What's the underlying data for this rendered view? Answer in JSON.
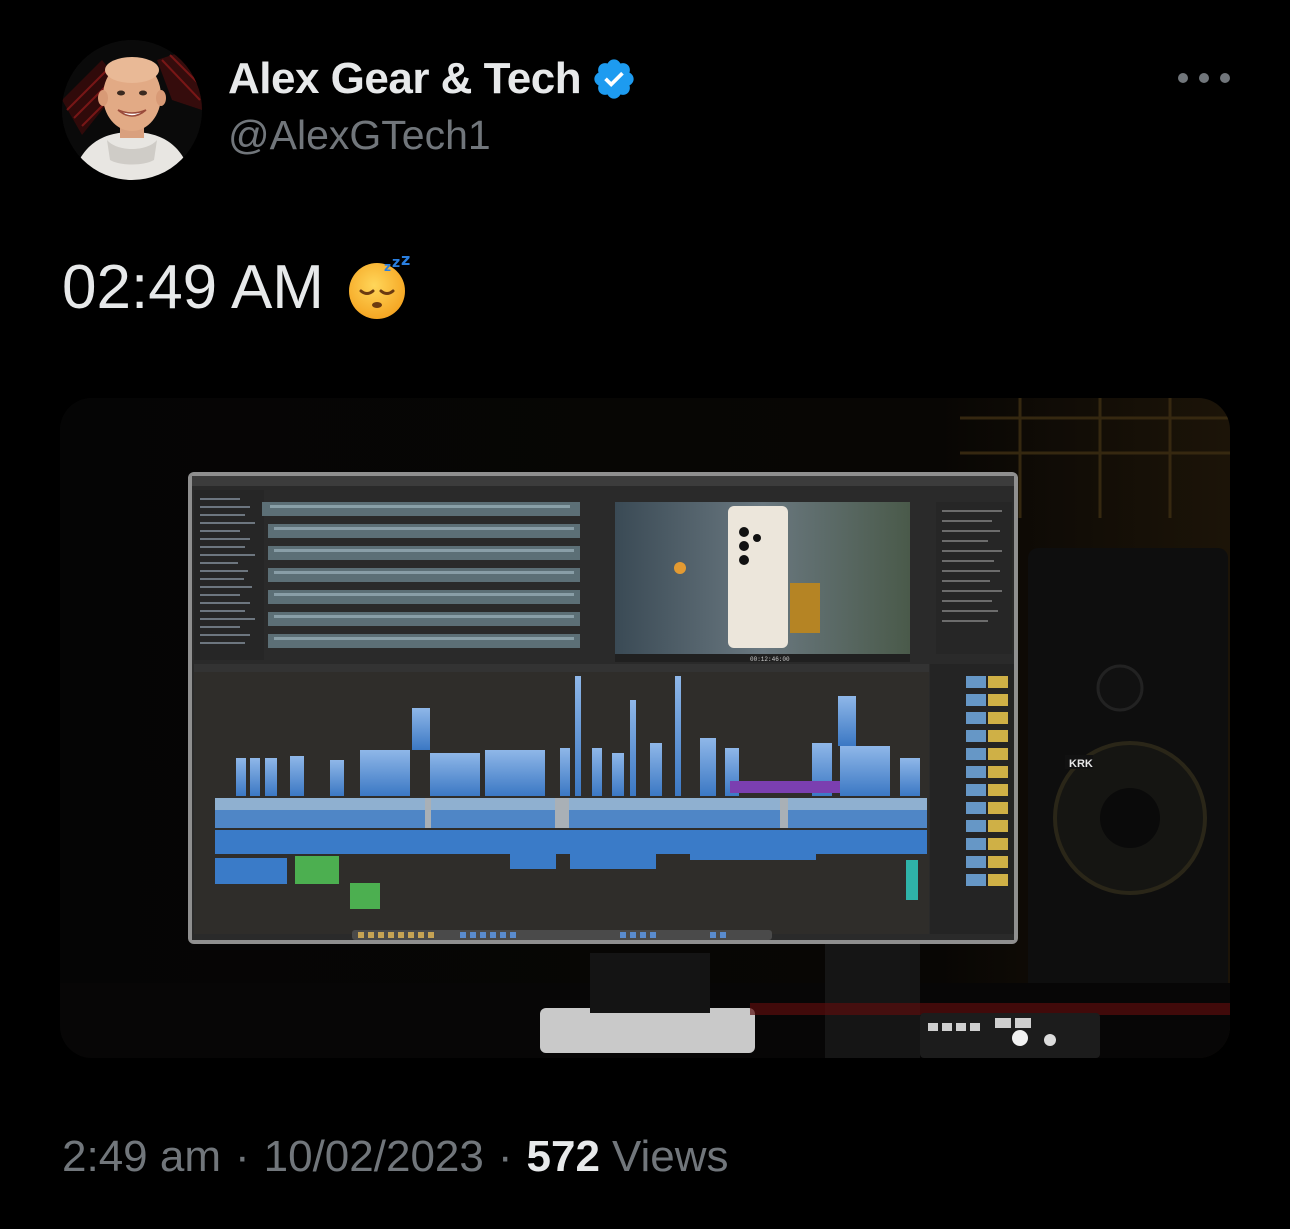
{
  "author": {
    "display_name": "Alex Gear & Tech",
    "handle": "@AlexGTech1",
    "verified": true,
    "avatar_icon": "profile-photo"
  },
  "more_icon": "ellipsis-icon",
  "tweet": {
    "text": "02:49 AM",
    "emoji": "sleeping-face-emoji"
  },
  "media": {
    "icon": "photo",
    "monitor_brand_label": "KRK",
    "viewer_timecode": "00:12:46:00"
  },
  "footer": {
    "time": "2:49 am",
    "separator": "·",
    "date": "10/02/2023",
    "views_count": "572",
    "views_label": "Views"
  },
  "colors": {
    "background": "#000000",
    "text_primary": "#e7e9ea",
    "text_secondary": "#71767b",
    "verified_blue": "#1d9bf0"
  }
}
